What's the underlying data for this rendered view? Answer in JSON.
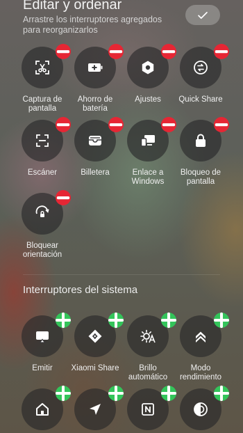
{
  "header": {
    "title": "Editar y ordenar",
    "subtitle": "Arrastre los interruptores agregados para reorganizarlos",
    "done_icon": "check-icon"
  },
  "added_toggles": [
    {
      "label": "Captura de pantalla",
      "icon": "screenshot-icon"
    },
    {
      "label": "Ahorro de batería",
      "icon": "battery-saver-icon"
    },
    {
      "label": "Ajustes",
      "icon": "settings-icon"
    },
    {
      "label": "Quick Share",
      "icon": "quick-share-icon"
    },
    {
      "label": "Escáner",
      "icon": "scanner-icon"
    },
    {
      "label": "Billetera",
      "icon": "wallet-icon"
    },
    {
      "label": "Enlace a Windows",
      "icon": "link-to-windows-icon"
    },
    {
      "label": "Bloqueo de pantalla",
      "icon": "lock-icon"
    },
    {
      "label": "Bloquear orientación",
      "icon": "rotation-lock-icon"
    }
  ],
  "system_section": {
    "title": "Interruptores del sistema",
    "toggles": [
      {
        "label": "Emitir",
        "icon": "cast-icon"
      },
      {
        "label": "Xiaomi Share",
        "icon": "xiaomi-share-icon"
      },
      {
        "label": "Brillo automático",
        "icon": "auto-brightness-icon"
      },
      {
        "label": "Modo rendimiento",
        "icon": "performance-mode-icon"
      },
      {
        "label": "",
        "icon": "home-icon"
      },
      {
        "label": "",
        "icon": "location-icon"
      },
      {
        "label": "",
        "icon": "nfc-icon"
      },
      {
        "label": "",
        "icon": "contrast-icon"
      }
    ]
  }
}
